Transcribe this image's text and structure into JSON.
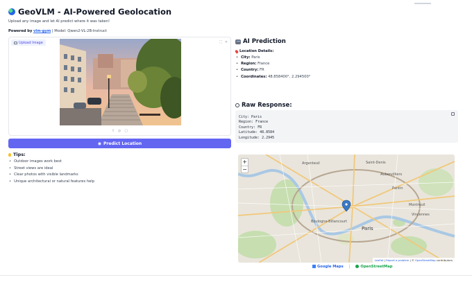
{
  "app": {
    "title": "GeoVLM - AI-Powered Geolocation",
    "subtitle": "Upload any image and let AI predict where it was taken!",
    "powered_prefix": "Powered by",
    "powered_link": "vlm-gym",
    "powered_suffix": "| Model: Qwen2-VL-2B-Instruct"
  },
  "image_panel": {
    "label": "Upload Image",
    "icons": [
      "expand-icon",
      "close-icon",
      "upload-icon",
      "webcam-icon",
      "clipboard-icon"
    ]
  },
  "predict_button": {
    "label": "Predict Location"
  },
  "tips": {
    "title": "Tips:",
    "items": [
      "Outdoor images work best",
      "Street views are ideal",
      "Clear photos with visible landmarks",
      "Unique architectural or natural features help"
    ]
  },
  "prediction": {
    "title": "AI Prediction",
    "location_heading": "Location Details:",
    "city_label": "City:",
    "city": "Paris",
    "region_label": "Region:",
    "region": "France",
    "country_label": "Country:",
    "country": "FR",
    "coords_label": "Coordinates:",
    "coords": "48.858400°, 2.294500°"
  },
  "raw": {
    "title": "Raw Response:",
    "text": "City: Paris\nRegion: France\nCountry: FR\nLatitude: 48.8584\nLongitude: 2.2945"
  },
  "map": {
    "zoom_in": "+",
    "zoom_out": "−",
    "labels": {
      "argenteuil": "Argenteuil",
      "saint_denis": "Saint-Denis",
      "aubervilliers": "Aubervilliers",
      "pantin": "Pantin",
      "boulogne": "Boulogne-Billancourt",
      "paris": "Paris",
      "montreuil": "Montreuil",
      "vincennes": "Vincennes"
    },
    "attribution_leaflet": "Leaflet",
    "attribution_report": "Report a problem",
    "attribution_osm": "OpenStreetMap",
    "attribution_suffix": "contributors"
  },
  "map_links": {
    "google": "Google Maps",
    "separator": "|",
    "osm": "OpenStreetMap"
  },
  "colors": {
    "accent": "#6366f1",
    "link": "#2563eb",
    "osm_green": "#16a34a"
  }
}
